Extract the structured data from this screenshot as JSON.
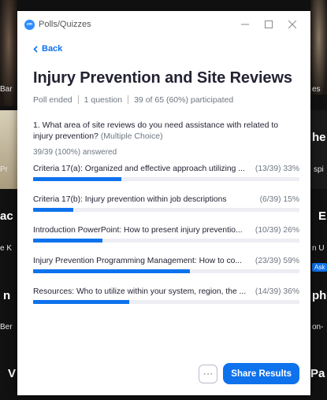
{
  "window": {
    "app_icon_text": "zm",
    "title": "Polls/Quizzes"
  },
  "back_label": "Back",
  "poll": {
    "title": "Injury Prevention and Site Reviews",
    "status": "Poll ended",
    "question_count": "1 question",
    "participation": "39 of 65 (60%) participated"
  },
  "question": {
    "text": "1. What area of site reviews do you need assistance with related to injury prevention?",
    "type": "(Multiple Choice)",
    "answered": "39/39 (100%) answered"
  },
  "options": [
    {
      "label": "Criteria 17(a): Organized and effective approach utilizing ...",
      "stat": "(13/39) 33%",
      "fraction": 0.33
    },
    {
      "label": "Criteria 17(b): Injury prevention within job descriptions",
      "stat": "(6/39) 15%",
      "fraction": 0.15
    },
    {
      "label": "Introduction PowerPoint: How to present injury preventio...",
      "stat": "(10/39) 26%",
      "fraction": 0.26
    },
    {
      "label": "Injury Prevention Programming Management: How to co...",
      "stat": "(23/39) 59%",
      "fraction": 0.59
    },
    {
      "label": "Resources: Who to utilize within your system, region, the ...",
      "stat": "(14/39) 36%",
      "fraction": 0.36
    }
  ],
  "footer": {
    "more_label": "···",
    "share_label": "Share Results"
  },
  "background": {
    "labels": [
      "Bar",
      "Pr",
      "ac",
      "e K",
      "n",
      "Ber",
      "V",
      "es",
      "he",
      "spi",
      "E",
      "n U",
      "Ask",
      "ph",
      "on-",
      "Pa"
    ]
  },
  "colors": {
    "accent": "#0e72ed",
    "bar_track": "#ededf4",
    "title_text": "#232333",
    "muted_text": "#6e7680"
  }
}
